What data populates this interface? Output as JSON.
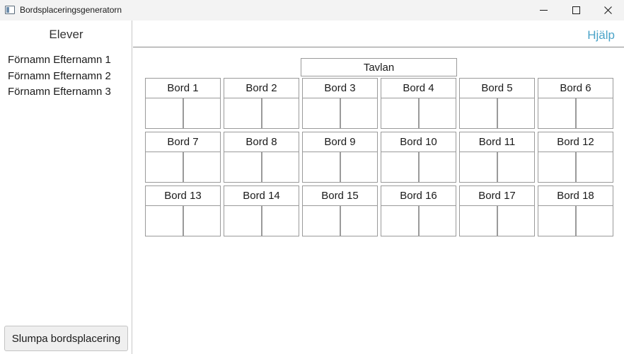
{
  "window": {
    "title": "Bordsplaceringsgeneratorn"
  },
  "sidebar": {
    "title": "Elever",
    "students": [
      "Förnamn Efternamn 1",
      "Förnamn Efternamn 2",
      "Förnamn Efternamn 3"
    ],
    "shuffle_button": "Slumpa bordsplacering"
  },
  "topbar": {
    "help": "Hjälp"
  },
  "board": {
    "label": "Tavlan"
  },
  "desks": [
    {
      "label": "Bord 1"
    },
    {
      "label": "Bord 2"
    },
    {
      "label": "Bord 3"
    },
    {
      "label": "Bord 4"
    },
    {
      "label": "Bord 5"
    },
    {
      "label": "Bord 6"
    },
    {
      "label": "Bord 7"
    },
    {
      "label": "Bord 8"
    },
    {
      "label": "Bord 9"
    },
    {
      "label": "Bord 10"
    },
    {
      "label": "Bord 11"
    },
    {
      "label": "Bord 12"
    },
    {
      "label": "Bord 13"
    },
    {
      "label": "Bord 14"
    },
    {
      "label": "Bord 15"
    },
    {
      "label": "Bord 16"
    },
    {
      "label": "Bord 17"
    },
    {
      "label": "Bord 18"
    }
  ],
  "icons": {
    "app": "app-window-icon",
    "minimize": "minimize-icon",
    "maximize": "maximize-icon",
    "close": "close-icon"
  },
  "colors": {
    "link": "#4aa3c8",
    "titlebar": "#f3f3f3",
    "border": "#9a9a9a"
  }
}
